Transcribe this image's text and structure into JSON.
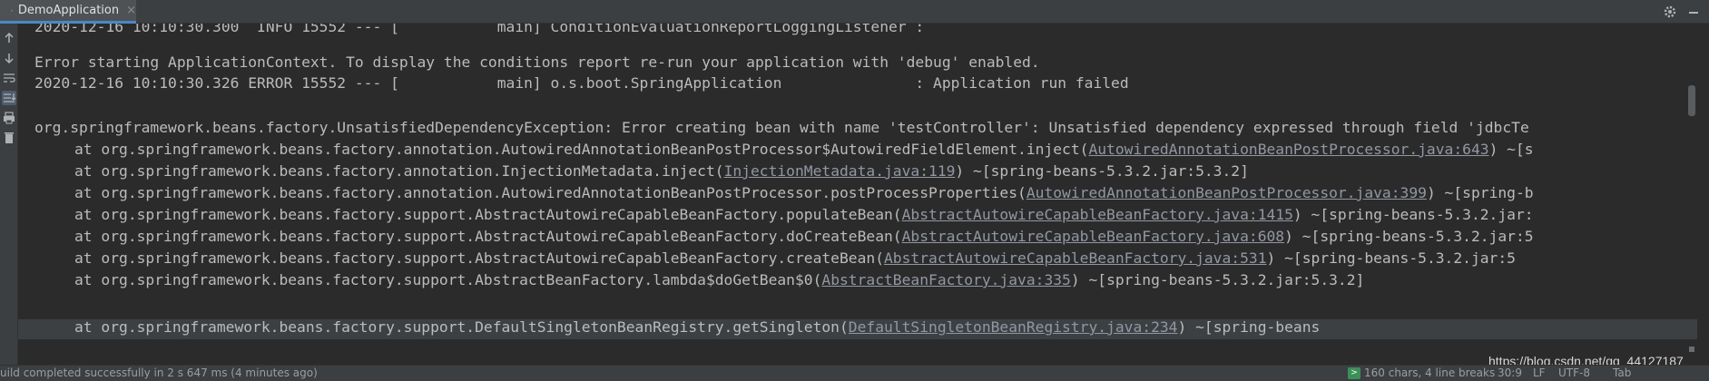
{
  "run_tab": {
    "label": "DemoApplication",
    "close": "×"
  },
  "console": {
    "partial_line": "2020-12-16 10:10:30.300  INFO 15552 --- [           main] ConditionEvaluationReportLoggingListener :",
    "error_msg": "Error starting ApplicationContext. To display the conditions report re-run your application with 'debug' enabled.",
    "error_line": "2020-12-16 10:10:30.326 ERROR 15552 --- [           main] o.s.boot.SpringApplication               : Application run failed",
    "exception_line": "org.springframework.beans.factory.UnsatisfiedDependencyException: Error creating bean with name 'testController': Unsatisfied dependency expressed through field 'jdbcTe",
    "stack": [
      {
        "pre": "at org.springframework.beans.factory.annotation.AutowiredAnnotationBeanPostProcessor$AutowiredFieldElement.inject(",
        "link": "AutowiredAnnotationBeanPostProcessor.java:643",
        "post": ") ~[s"
      },
      {
        "pre": "at org.springframework.beans.factory.annotation.InjectionMetadata.inject(",
        "link": "InjectionMetadata.java:119",
        "post": ") ~[spring-beans-5.3.2.jar:5.3.2]"
      },
      {
        "pre": "at org.springframework.beans.factory.annotation.AutowiredAnnotationBeanPostProcessor.postProcessProperties(",
        "link": "AutowiredAnnotationBeanPostProcessor.java:399",
        "post": ") ~[spring-b"
      },
      {
        "pre": "at org.springframework.beans.factory.support.AbstractAutowireCapableBeanFactory.populateBean(",
        "link": "AbstractAutowireCapableBeanFactory.java:1415",
        "post": ") ~[spring-beans-5.3.2.jar:"
      },
      {
        "pre": "at org.springframework.beans.factory.support.AbstractAutowireCapableBeanFactory.doCreateBean(",
        "link": "AbstractAutowireCapableBeanFactory.java:608",
        "post": ") ~[spring-beans-5.3.2.jar:5"
      },
      {
        "pre": "at org.springframework.beans.factory.support.AbstractAutowireCapableBeanFactory.createBean(",
        "link": "AbstractAutowireCapableBeanFactory.java:531",
        "post": ") ~[spring-beans-5.3.2.jar:5"
      },
      {
        "pre": "at org.springframework.beans.factory.support.AbstractBeanFactory.lambda$doGetBean$0(",
        "link": "AbstractBeanFactory.java:335",
        "post": ") ~[spring-beans-5.3.2.jar:5.3.2]"
      },
      {
        "pre": "at org.springframework.beans.factory.support.DefaultSingletonBeanRegistry.getSingleton(",
        "link": "DefaultSingletonBeanRegistry.java:234",
        "post": ") ~[spring-beans"
      }
    ]
  },
  "watermark": "https://blog.csdn.net/qq_44127187",
  "status": {
    "message": "uild completed successfully in 2 s 647 ms (4 minutes ago)",
    "chars": "160 chars, 4 line breaks",
    "position": "30:9",
    "line_sep": "LF",
    "encoding": "UTF-8",
    "indent": "Tab"
  },
  "colors": {
    "background": "#2b2b2b",
    "text": "#bbbbbb",
    "link": "#9197a3",
    "accent": "#4a88c7"
  },
  "icons": [
    "gear-icon",
    "minimize-icon",
    "arrow-up-icon",
    "arrow-down-icon",
    "soft-wrap-icon",
    "scroll-to-end-icon",
    "print-icon",
    "trash-icon",
    "terminal-icon"
  ]
}
